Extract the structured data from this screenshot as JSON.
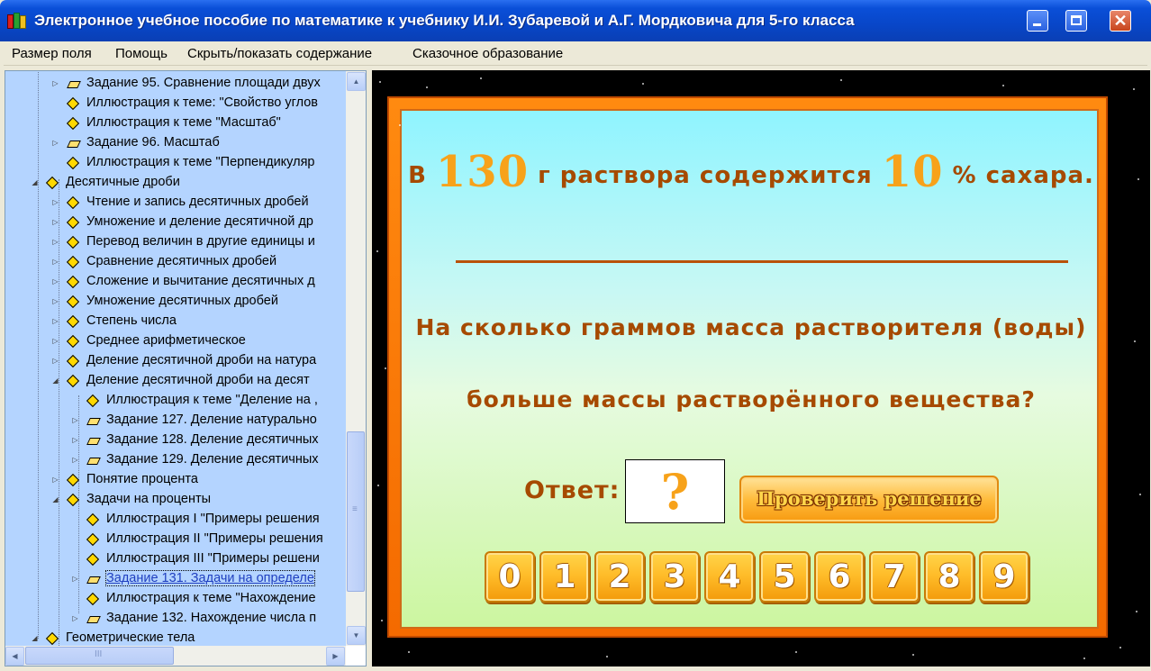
{
  "window": {
    "title": "Электронное учебное пособие по математике к учебнику И.И. Зубаревой и А.Г. Мордковича для 5-го класса",
    "minimize_glyph": "",
    "maximize_glyph": "",
    "close_glyph": "✕"
  },
  "menu": {
    "items": [
      "Размер поля",
      "Помощь",
      "Скрыть/показать содержание",
      "Сказочное образование"
    ]
  },
  "tree": {
    "items": [
      {
        "label": "Задание 95. Сравнение площади двух",
        "expander": "closed",
        "icon": "book-diamond-icon",
        "level": 2
      },
      {
        "label": "Иллюстрация к теме: \"Свойство углов",
        "expander": "none",
        "icon": "diamond-icon",
        "level": 2
      },
      {
        "label": "Иллюстрация к теме \"Масштаб\"",
        "expander": "none",
        "icon": "diamond-icon",
        "level": 2
      },
      {
        "label": "Задание 96. Масштаб",
        "expander": "closed",
        "icon": "book-diamond-icon",
        "level": 2
      },
      {
        "label": "Иллюстрация к теме \"Перпендикуляр",
        "expander": "none",
        "icon": "diamond-icon",
        "level": 2
      },
      {
        "label": "Десятичные дроби",
        "expander": "open",
        "icon": "diamond-icon",
        "level": 1
      },
      {
        "label": "Чтение и запись десятичных дробей",
        "expander": "closed",
        "icon": "diamond-icon",
        "level": 2
      },
      {
        "label": "Умножение и деление десятичной др",
        "expander": "closed",
        "icon": "diamond-icon",
        "level": 2
      },
      {
        "label": "Перевод величин в другие единицы и",
        "expander": "closed",
        "icon": "diamond-icon",
        "level": 2
      },
      {
        "label": "Сравнение десятичных дробей",
        "expander": "closed",
        "icon": "diamond-icon",
        "level": 2
      },
      {
        "label": "Сложение и вычитание десятичных д",
        "expander": "closed",
        "icon": "diamond-icon",
        "level": 2
      },
      {
        "label": "Умножение десятичных дробей",
        "expander": "closed",
        "icon": "diamond-icon",
        "level": 2
      },
      {
        "label": "Степень числа",
        "expander": "closed",
        "icon": "diamond-icon",
        "level": 2
      },
      {
        "label": "Среднее арифметическое",
        "expander": "closed",
        "icon": "diamond-icon",
        "level": 2
      },
      {
        "label": "Деление десятичной дроби на натура",
        "expander": "closed",
        "icon": "diamond-icon",
        "level": 2
      },
      {
        "label": "Деление десятичной дроби на десят",
        "expander": "open",
        "icon": "diamond-icon",
        "level": 2
      },
      {
        "label": "Иллюстрация к теме \"Деление на ,",
        "expander": "none",
        "icon": "diamond-icon",
        "level": 3
      },
      {
        "label": "Задание 127. Деление натурально",
        "expander": "closed",
        "icon": "book-diamond-icon",
        "level": 3
      },
      {
        "label": "Задание 128. Деление десятичных",
        "expander": "closed",
        "icon": "book-diamond-icon",
        "level": 3
      },
      {
        "label": "Задание 129. Деление десятичных",
        "expander": "closed",
        "icon": "book-diamond-icon",
        "level": 3
      },
      {
        "label": "Понятие процента",
        "expander": "closed",
        "icon": "diamond-icon",
        "level": 2
      },
      {
        "label": "Задачи на проценты",
        "expander": "open",
        "icon": "diamond-icon",
        "level": 2
      },
      {
        "label": "Иллюстрация I \"Примеры решения",
        "expander": "none",
        "icon": "diamond-icon",
        "level": 3
      },
      {
        "label": "Иллюстрация II \"Примеры решения",
        "expander": "none",
        "icon": "diamond-icon",
        "level": 3
      },
      {
        "label": "Иллюстрация III \"Примеры решени",
        "expander": "none",
        "icon": "diamond-icon",
        "level": 3
      },
      {
        "label": "Задание 131. Задачи на определе",
        "expander": "closed",
        "icon": "open-book-icon",
        "level": 3,
        "selected": true
      },
      {
        "label": "Иллюстрация к теме \"Нахождение",
        "expander": "none",
        "icon": "diamond-icon",
        "level": 3
      },
      {
        "label": "Задание 132. Нахождение числа п",
        "expander": "closed",
        "icon": "book-diamond-icon",
        "level": 3
      },
      {
        "label": "Геометрические тела",
        "expander": "open",
        "icon": "diamond-icon",
        "level": 1
      }
    ]
  },
  "scrollbars": {
    "up": "▲",
    "down": "▼",
    "left": "◀",
    "right": "▶",
    "v_grip": "≡",
    "h_grip": "III"
  },
  "exercise": {
    "statement": {
      "part1": "В",
      "number1": "130",
      "part2": "г раствора содержится",
      "number2": "10",
      "part3": "% сахара."
    },
    "question_line1": "На сколько граммов масса растворителя (воды)",
    "question_line2": "больше массы растворённого вещества?",
    "answer_label": "Ответ:",
    "answer_value": "?",
    "check_button": "Проверить решение",
    "digits": [
      "0",
      "1",
      "2",
      "3",
      "4",
      "5",
      "6",
      "7",
      "8",
      "9"
    ]
  },
  "colors": {
    "accent_orange": "#f7a21a",
    "text_brown": "#a64a00",
    "frame_orange": "#f46a00",
    "tree_background": "#b4d4ff",
    "titlebar_blue": "#0a4fd8"
  }
}
